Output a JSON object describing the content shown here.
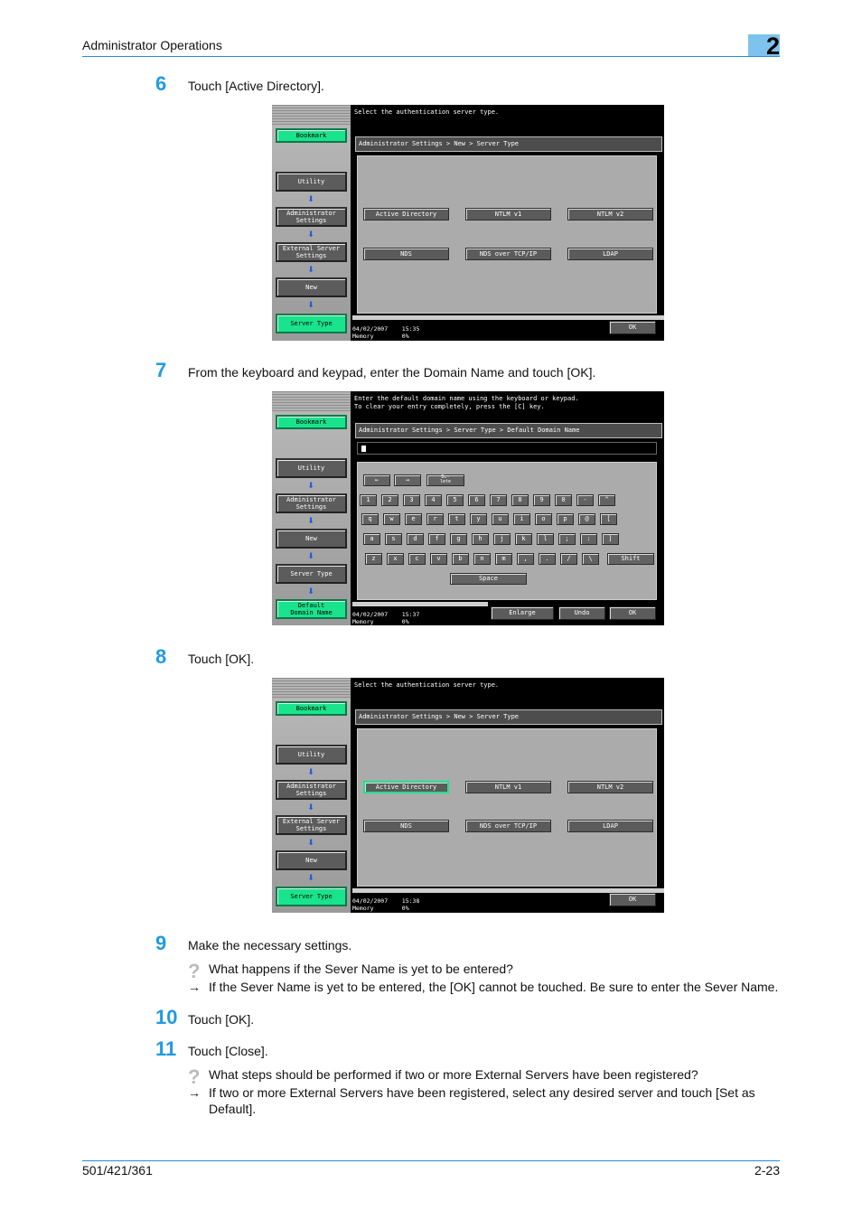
{
  "header": {
    "title": "Administrator Operations",
    "chapter": "2"
  },
  "steps": {
    "s6": {
      "num": "6",
      "text": "Touch [Active Directory]."
    },
    "s7": {
      "num": "7",
      "text": "From the keyboard and keypad, enter the Domain Name and touch [OK]."
    },
    "s8": {
      "num": "8",
      "text": "Touch [OK]."
    },
    "s9": {
      "num": "9",
      "text": "Make the necessary settings."
    },
    "s10": {
      "num": "10",
      "text": "Touch [OK]."
    },
    "s11": {
      "num": "11",
      "text": "Touch [Close]."
    }
  },
  "qa": {
    "q1": {
      "mark": "?",
      "text": "What happens if the Sever Name is yet to be entered?"
    },
    "a1": {
      "arrow": "→",
      "text": "If the Sever Name is yet to be entered, the [OK] cannot be touched. Be sure to enter the Sever Name."
    },
    "q2": {
      "mark": "?",
      "text": "What steps should be performed if two or more External Servers have been registered?"
    },
    "a2": {
      "arrow": "→",
      "text": "If two or more External Servers have been registered, select any desired server and touch [Set as Default]."
    }
  },
  "footer": {
    "model": "501/421/361",
    "page": "2-23"
  },
  "panels": {
    "p1": {
      "message": "Select the authentication server type.",
      "breadcrumb": "Administrator Settings > New > Server Type",
      "sidebar": [
        "Bookmark",
        "Utility",
        "Administrator\nSettings",
        "External Server\nSettings",
        "New",
        "Server Type"
      ],
      "options": [
        "Active Directory",
        "NTLM v1",
        "NTLM v2",
        "NDS",
        "NDS over TCP/IP",
        "LDAP"
      ],
      "date": "04/02/2007",
      "time": "15:35",
      "memory_label": "Memory",
      "memory_value": "0%",
      "ok": "OK"
    },
    "p2": {
      "message": "Enter the default domain name using the keyboard or keypad.\nTo clear your entry completely, press the [C] key.",
      "breadcrumb": "Administrator Settings > Server Type > Default Domain Name",
      "sidebar": [
        "Bookmark",
        "Utility",
        "Administrator\nSettings",
        "New",
        "Server Type",
        "Default\nDomain Name"
      ],
      "nav_keys": [
        "←",
        "→",
        "Dc-\nlete"
      ],
      "row1": [
        "1",
        "2",
        "3",
        "4",
        "5",
        "6",
        "7",
        "8",
        "9",
        "0",
        "-",
        "^"
      ],
      "row2": [
        "q",
        "w",
        "e",
        "r",
        "t",
        "y",
        "u",
        "i",
        "o",
        "p",
        "@",
        "["
      ],
      "row3": [
        "a",
        "s",
        "d",
        "f",
        "g",
        "h",
        "j",
        "k",
        "l",
        ";",
        ":",
        "]"
      ],
      "row4": [
        "z",
        "x",
        "c",
        "v",
        "b",
        "n",
        "m",
        ",",
        ".",
        "/",
        "\\"
      ],
      "shift": "Shift",
      "space": "Space",
      "enlarge": "Enlarge",
      "undo": "Undo",
      "ok": "OK",
      "date": "04/02/2007",
      "time": "15:37",
      "memory_label": "Memory",
      "memory_value": "0%"
    },
    "p3": {
      "message": "Select the authentication server type.",
      "breadcrumb": "Administrator Settings > New > Server Type",
      "sidebar": [
        "Bookmark",
        "Utility",
        "Administrator\nSettings",
        "External Server\nSettings",
        "New",
        "Server Type"
      ],
      "options": [
        "Active Directory",
        "NTLM v1",
        "NTLM v2",
        "NDS",
        "NDS over TCP/IP",
        "LDAP"
      ],
      "selected_option": "Active Directory",
      "date": "04/02/2007",
      "time": "15:38",
      "memory_label": "Memory",
      "memory_value": "0%",
      "ok": "OK"
    }
  },
  "colors": {
    "accent_blue": "#1f9be0",
    "panel_green": "#19e38c"
  }
}
